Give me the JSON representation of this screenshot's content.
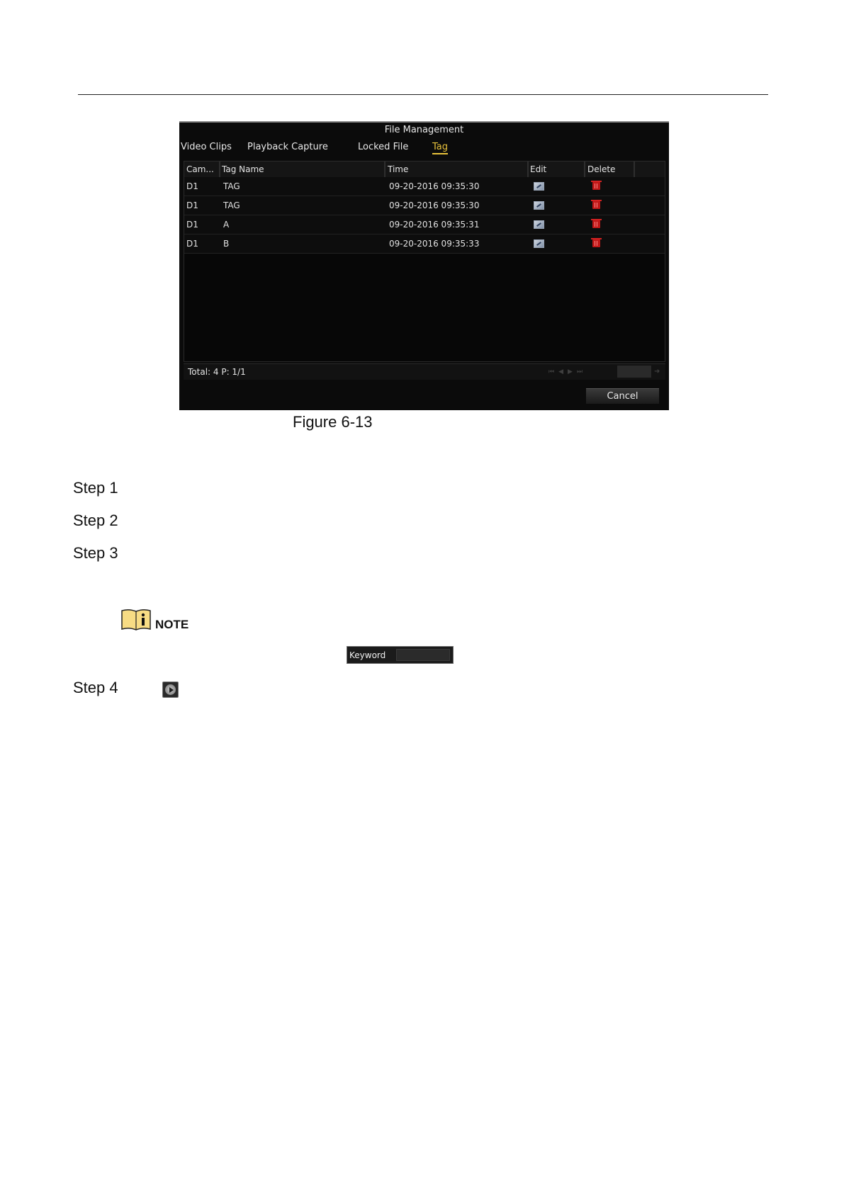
{
  "dialog": {
    "title": "File Management",
    "tabs": [
      "Video Clips",
      "Playback Capture",
      "Locked File",
      "Tag"
    ],
    "active_tab": "Tag",
    "columns": [
      "Cam...",
      "Tag Name",
      "Time",
      "Edit",
      "Delete"
    ],
    "rows": [
      {
        "cam": "D1",
        "tag": "TAG",
        "time": "09-20-2016 09:35:30"
      },
      {
        "cam": "D1",
        "tag": "TAG",
        "time": "09-20-2016 09:35:30"
      },
      {
        "cam": "D1",
        "tag": "A",
        "time": "09-20-2016 09:35:31"
      },
      {
        "cam": "D1",
        "tag": "B",
        "time": "09-20-2016 09:35:33"
      }
    ],
    "total": "Total: 4 P: 1/1",
    "cancel_label": "Cancel",
    "accent_color": "#e8c23b",
    "delete_icon_color": "#c01818"
  },
  "caption": "Figure 6-13",
  "steps": [
    "Step 1",
    "Step 2",
    "Step 3",
    "Step 4"
  ],
  "note": {
    "label": "NOTE"
  },
  "keyword": {
    "label": "Keyword"
  }
}
